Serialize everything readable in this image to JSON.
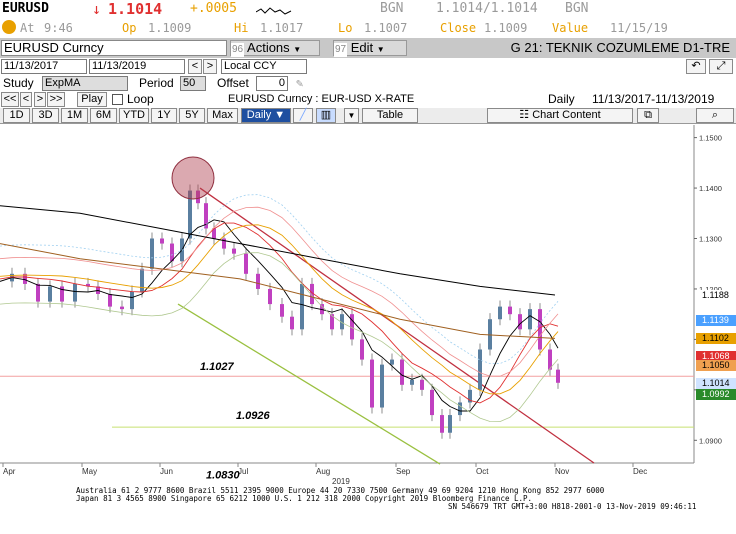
{
  "ticker": {
    "symbol": "EURUSD",
    "arrow": "↓",
    "last": "1.1014",
    "change": "+.0005",
    "bid_lbl": "BGN",
    "bidask": "1.1014/1.1014",
    "src": "BGN"
  },
  "quote": {
    "at_lbl": "At",
    "at": "9:46",
    "op_lbl": "Op",
    "op": "1.1009",
    "hi_lbl": "Hi",
    "hi": "1.1017",
    "lo_lbl": "Lo",
    "lo": "1.1007",
    "close_lbl": "Close",
    "close": "1.1009",
    "val_lbl": "Value",
    "val": "11/15/19"
  },
  "toolbar": {
    "security": "EURUSD  Curncy",
    "actions_num": "96",
    "actions": "Actions",
    "edit_num": "97",
    "edit": "Edit",
    "title": "G 21: TEKNIK COZUMLEME D1-TRE"
  },
  "dates": {
    "start": "11/13/2017",
    "end": "11/13/2019",
    "ccy": "Local CCY"
  },
  "study": {
    "label": "Study",
    "value": "ExpMA",
    "period_lbl": "Period",
    "period": "50",
    "offset_lbl": "Offset",
    "offset": "0"
  },
  "play": {
    "play": "Play",
    "loop": "Loop",
    "desc": "EURUSD  Curncy : EUR-USD X-RATE",
    "freq": "Daily",
    "range": "11/13/2017-11/13/2019"
  },
  "periods": [
    "1D",
    "3D",
    "1M",
    "6M",
    "YTD",
    "1Y",
    "5Y",
    "Max"
  ],
  "freq_sel": "Daily",
  "table_lbl": "Table",
  "chart_content": "Chart Content",
  "chart_data": {
    "type": "line",
    "ticks": [
      "1.1500",
      "1.1400",
      "1.1300",
      "1.1200",
      "1.1100",
      "1.1000",
      "1.0900"
    ],
    "months": [
      "Apr",
      "May",
      "Jun",
      "Jul",
      "Aug",
      "Sep",
      "Oct",
      "Nov",
      "Dec"
    ],
    "year": "2019",
    "levels": [
      {
        "label": "1.1027",
        "value": 1.1027
      },
      {
        "label": "1.0926",
        "value": 1.0926
      },
      {
        "label": "1.0830",
        "value": 1.083
      }
    ],
    "tags": [
      {
        "label": "1.1188",
        "value": 1.1188,
        "color": "#ffffff",
        "text": "#000000"
      },
      {
        "label": "1.1139",
        "value": 1.1139,
        "color": "#4aa0ff",
        "text": "#ffffff"
      },
      {
        "label": "1.1102",
        "value": 1.1102,
        "color": "#e8a000",
        "text": "#000000"
      },
      {
        "label": "1.1068",
        "value": 1.1068,
        "color": "#e03030",
        "text": "#ffffff"
      },
      {
        "label": "1.1050",
        "value": 1.105,
        "color": "#f0a050",
        "text": "#000000"
      },
      {
        "label": "1.1014",
        "value": 1.1014,
        "color": "#cfe3ff",
        "text": "#000000"
      },
      {
        "label": "1.0992",
        "value": 1.0992,
        "color": "#2a8a2a",
        "text": "#ffffff"
      }
    ],
    "y_range": [
      1.0855,
      1.1525
    ]
  },
  "footer": {
    "l1": "Australia 61 2 9777 8600 Brazil 5511 2395 9000 Europe 44 20 7330 7500 Germany 49 69 9204 1210 Hong Kong 852 2977 6000",
    "l2": "Japan 81 3 4565 8900     Singapore 65 6212 1000     U.S. 1 212 318 2000          Copyright 2019 Bloomberg Finance L.P.",
    "l3": "SN 546679 TRT  GMT+3:00 H818-2001-0 13-Nov-2019 09:46:11"
  },
  "colors": {
    "accent": "#e8a000",
    "down": "#e03030",
    "toolbar": "#c8c8c8"
  }
}
